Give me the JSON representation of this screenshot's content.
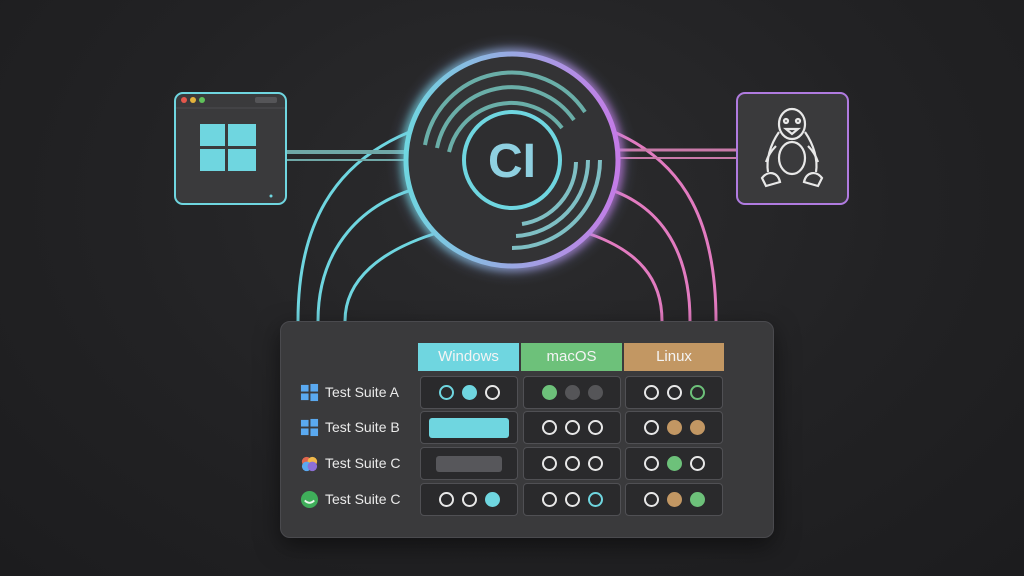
{
  "hub": {
    "label": "CI"
  },
  "nodes": {
    "left": "windows-icon",
    "right": "linux-tux-icon"
  },
  "columns": [
    {
      "label": "Windows",
      "color": "#6fd6e0"
    },
    {
      "label": "macOS",
      "color": "#6dc17a"
    },
    {
      "label": "Linux",
      "color": "#c29763"
    }
  ],
  "rows": [
    {
      "label": "Test Suite A",
      "icon": "windows-icon",
      "cells": [
        [
          "ring-cyan",
          "cyan",
          "ring"
        ],
        [
          "green",
          "gray",
          "gray"
        ],
        [
          "ring",
          "ring",
          "ring-green"
        ]
      ]
    },
    {
      "label": "Test Suite B",
      "icon": "windows-icon",
      "cells": [
        [
          "bar-cyan"
        ],
        [
          "ring",
          "ring",
          "ring"
        ],
        [
          "ring",
          "tan",
          "tan"
        ]
      ]
    },
    {
      "label": "Test Suite C",
      "icon": "apple-multicolor-icon",
      "cells": [
        [
          "bar-gray"
        ],
        [
          "ring",
          "ring",
          "ring"
        ],
        [
          "ring",
          "green",
          "ring"
        ]
      ]
    },
    {
      "label": "Test Suite C",
      "icon": "green-smile-icon",
      "cells": [
        [
          "ring",
          "ring",
          "cyan"
        ],
        [
          "ring",
          "ring",
          "ring-cyan"
        ],
        [
          "ring",
          "tan",
          "green"
        ]
      ]
    }
  ],
  "colors": {
    "cyan": "#6fd6e0",
    "pink": "#e27bc0",
    "purple": "#b07be0",
    "green": "#6dc17a",
    "tan": "#c29763"
  }
}
